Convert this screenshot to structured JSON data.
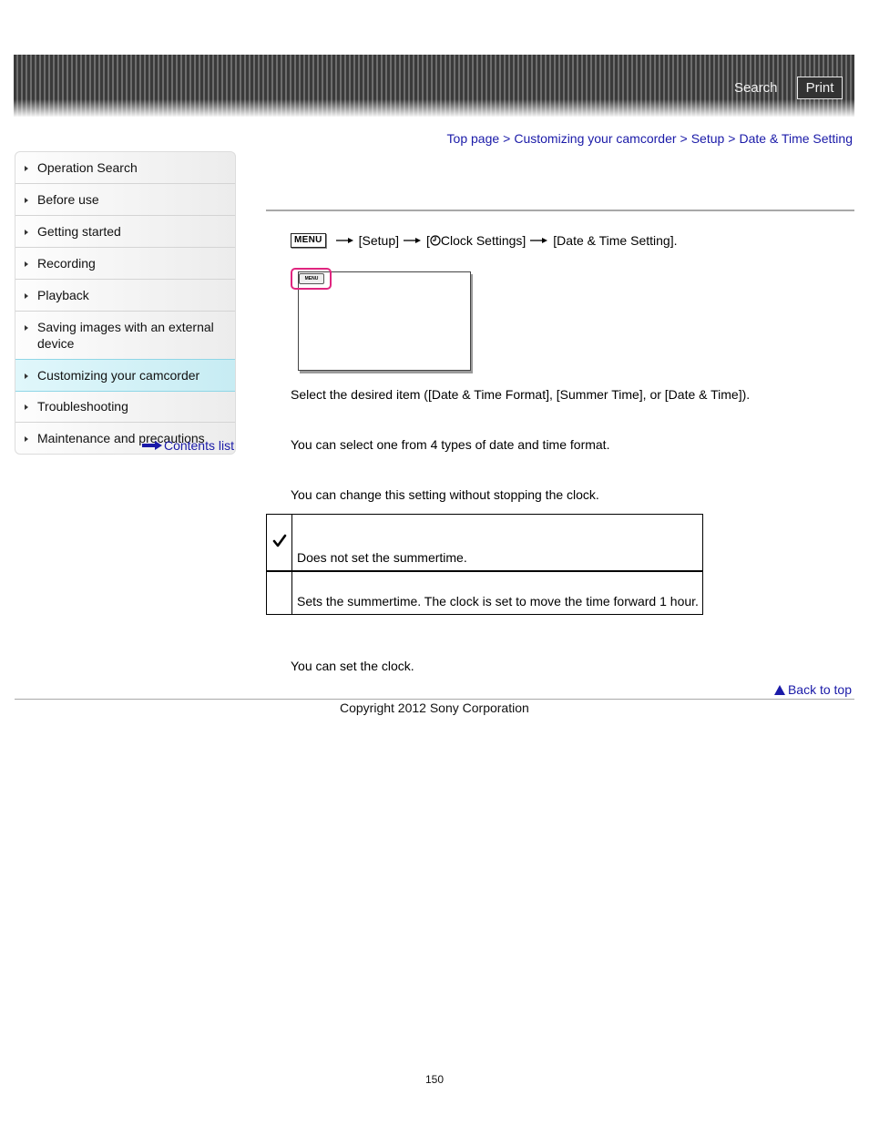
{
  "header": {
    "search_label": "Search",
    "print_label": "Print"
  },
  "breadcrumb": {
    "items": [
      "Top page",
      "Customizing your camcorder",
      "Setup",
      "Date & Time Setting"
    ],
    "separator": ">"
  },
  "sidebar": {
    "items": [
      {
        "label": "Operation Search"
      },
      {
        "label": "Before use"
      },
      {
        "label": "Getting started"
      },
      {
        "label": "Recording"
      },
      {
        "label": "Playback"
      },
      {
        "label": "Saving images with an external device"
      },
      {
        "label": "Customizing your camcorder",
        "active": true
      },
      {
        "label": "Troubleshooting"
      },
      {
        "label": "Maintenance and precautions"
      }
    ],
    "contents_link": "Contents list"
  },
  "main": {
    "step": {
      "menu_key": "MENU",
      "part1": "[Setup]",
      "part2_open": "[",
      "part2_label": "Clock Settings]",
      "part3": "[Date & Time Setting]."
    },
    "screen_illustration": {
      "menu_button_label": "MENU",
      "highlight_color": "#e0257f"
    },
    "select_instruction": "Select the desired item ([Date & Time Format], [Summer Time], or [Date & Time]).",
    "format_desc": "You can select one from 4 types of date and time format.",
    "summer_desc": "You can change this setting without stopping the clock.",
    "options_table": [
      {
        "selected": true,
        "description": "Does not set the summertime."
      },
      {
        "selected": false,
        "description": "Sets the summertime. The clock is set to move the time forward 1 hour."
      }
    ],
    "clock_desc": "You can set the clock."
  },
  "footer": {
    "back_to_top": "Back to top",
    "copyright": "Copyright 2012 Sony Corporation",
    "page_number": "150"
  },
  "colors": {
    "link": "#1a1aa8",
    "active_sidebar": "#c7ecf3",
    "highlight": "#e0257f"
  }
}
